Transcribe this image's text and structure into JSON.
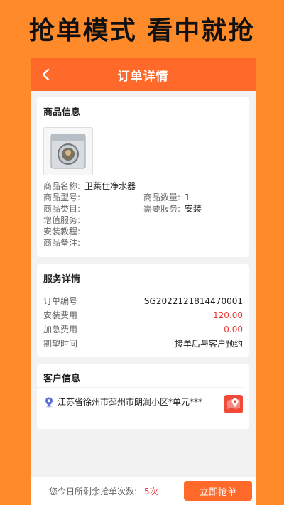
{
  "promo": {
    "title": "抢单模式  看中就抢"
  },
  "nav": {
    "title": "订单详情"
  },
  "product": {
    "section_title": "商品信息",
    "name_label": "商品名称:",
    "name_value": "卫莱仕净水器",
    "model_label": "商品型号:",
    "model_value": "",
    "quantity_label": "商品数量:",
    "quantity_value": "1",
    "category_label": "商品类目:",
    "category_value": "",
    "service_label": "需要服务:",
    "service_value": "安装",
    "addon_label": "增值服务:",
    "tutorial_label": "安装教程:",
    "remark_label": "商品备注:"
  },
  "service": {
    "section_title": "服务详情",
    "rows": [
      {
        "label": "订单编号",
        "value": "SG2022121814470001"
      },
      {
        "label": "安装费用",
        "value": "120.00"
      },
      {
        "label": "加急费用",
        "value": "0.00"
      },
      {
        "label": "期望时间",
        "value": "接单后与客户预约"
      }
    ]
  },
  "customer": {
    "section_title": "客户信息",
    "address": "江苏省徐州市邳州市朗润小区*单元***"
  },
  "footer": {
    "remain_label": "您今日所剩余抢单次数:",
    "remain_count": "5次",
    "grab_button": "立即抢单"
  },
  "colors": {
    "accent": "#ff6a2a",
    "background": "#ff8a2a",
    "price": "#e53935"
  }
}
